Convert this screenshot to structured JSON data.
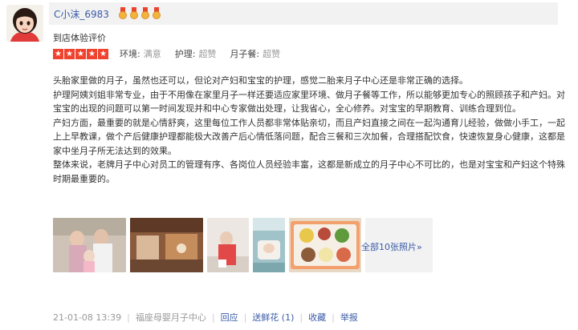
{
  "user": {
    "name": "C小沫_6983",
    "badge_count": 4
  },
  "review": {
    "type_label": "到店体验评价",
    "star_count": 5,
    "ratings": [
      {
        "label": "环境:",
        "value": "满意"
      },
      {
        "label": "护理:",
        "value": "超赞"
      },
      {
        "label": "月子餐:",
        "value": "超赞"
      }
    ],
    "paragraphs": [
      "头胎家里做的月子，虽然也还可以，但论对产妇和宝宝的护理，感觉二胎来月子中心还是非常正确的选择。",
      "护理阿姨刘姐非常专业，由于不用像在家里月子一样还要适应家里环境、做月子餐等工作，所以能够更加专心的照顾孩子和产妇。对宝宝的出现的问题可以第一时间发现并和中心专家做出处理，让我省心，全心修养。对宝宝的早期教育、训练合理到位。",
      "产妇方面，最重要的就是心情舒爽，这里每位工作人员都非常体贴亲切，而且产妇直接之间在一起沟通育儿经验，做做小手工，一起上上早教课，做个产后健康护理都能极大改善产后心情低落问题，配合三餐和三次加餐，合理搭配饮食，快速恢复身心健康，这都是家中坐月子所无法达到的效果。",
      "整体来说，老牌月子中心对员工的管理有序、各岗位人员经验丰富，这都是新成立的月子中心不可比的，也是对宝宝和产妇这个特殊时期最重要的。"
    ],
    "more_photos": "全部10张照片»"
  },
  "footer": {
    "date": "21-01-08 13:39",
    "shop": "福座母婴月子中心",
    "reply": "回应",
    "flower": "送鲜花 (1)",
    "favorite": "收藏",
    "report": "举报"
  },
  "colors": {
    "link": "#3a5ba8",
    "star": "#f0432f",
    "muted": "#999999"
  }
}
